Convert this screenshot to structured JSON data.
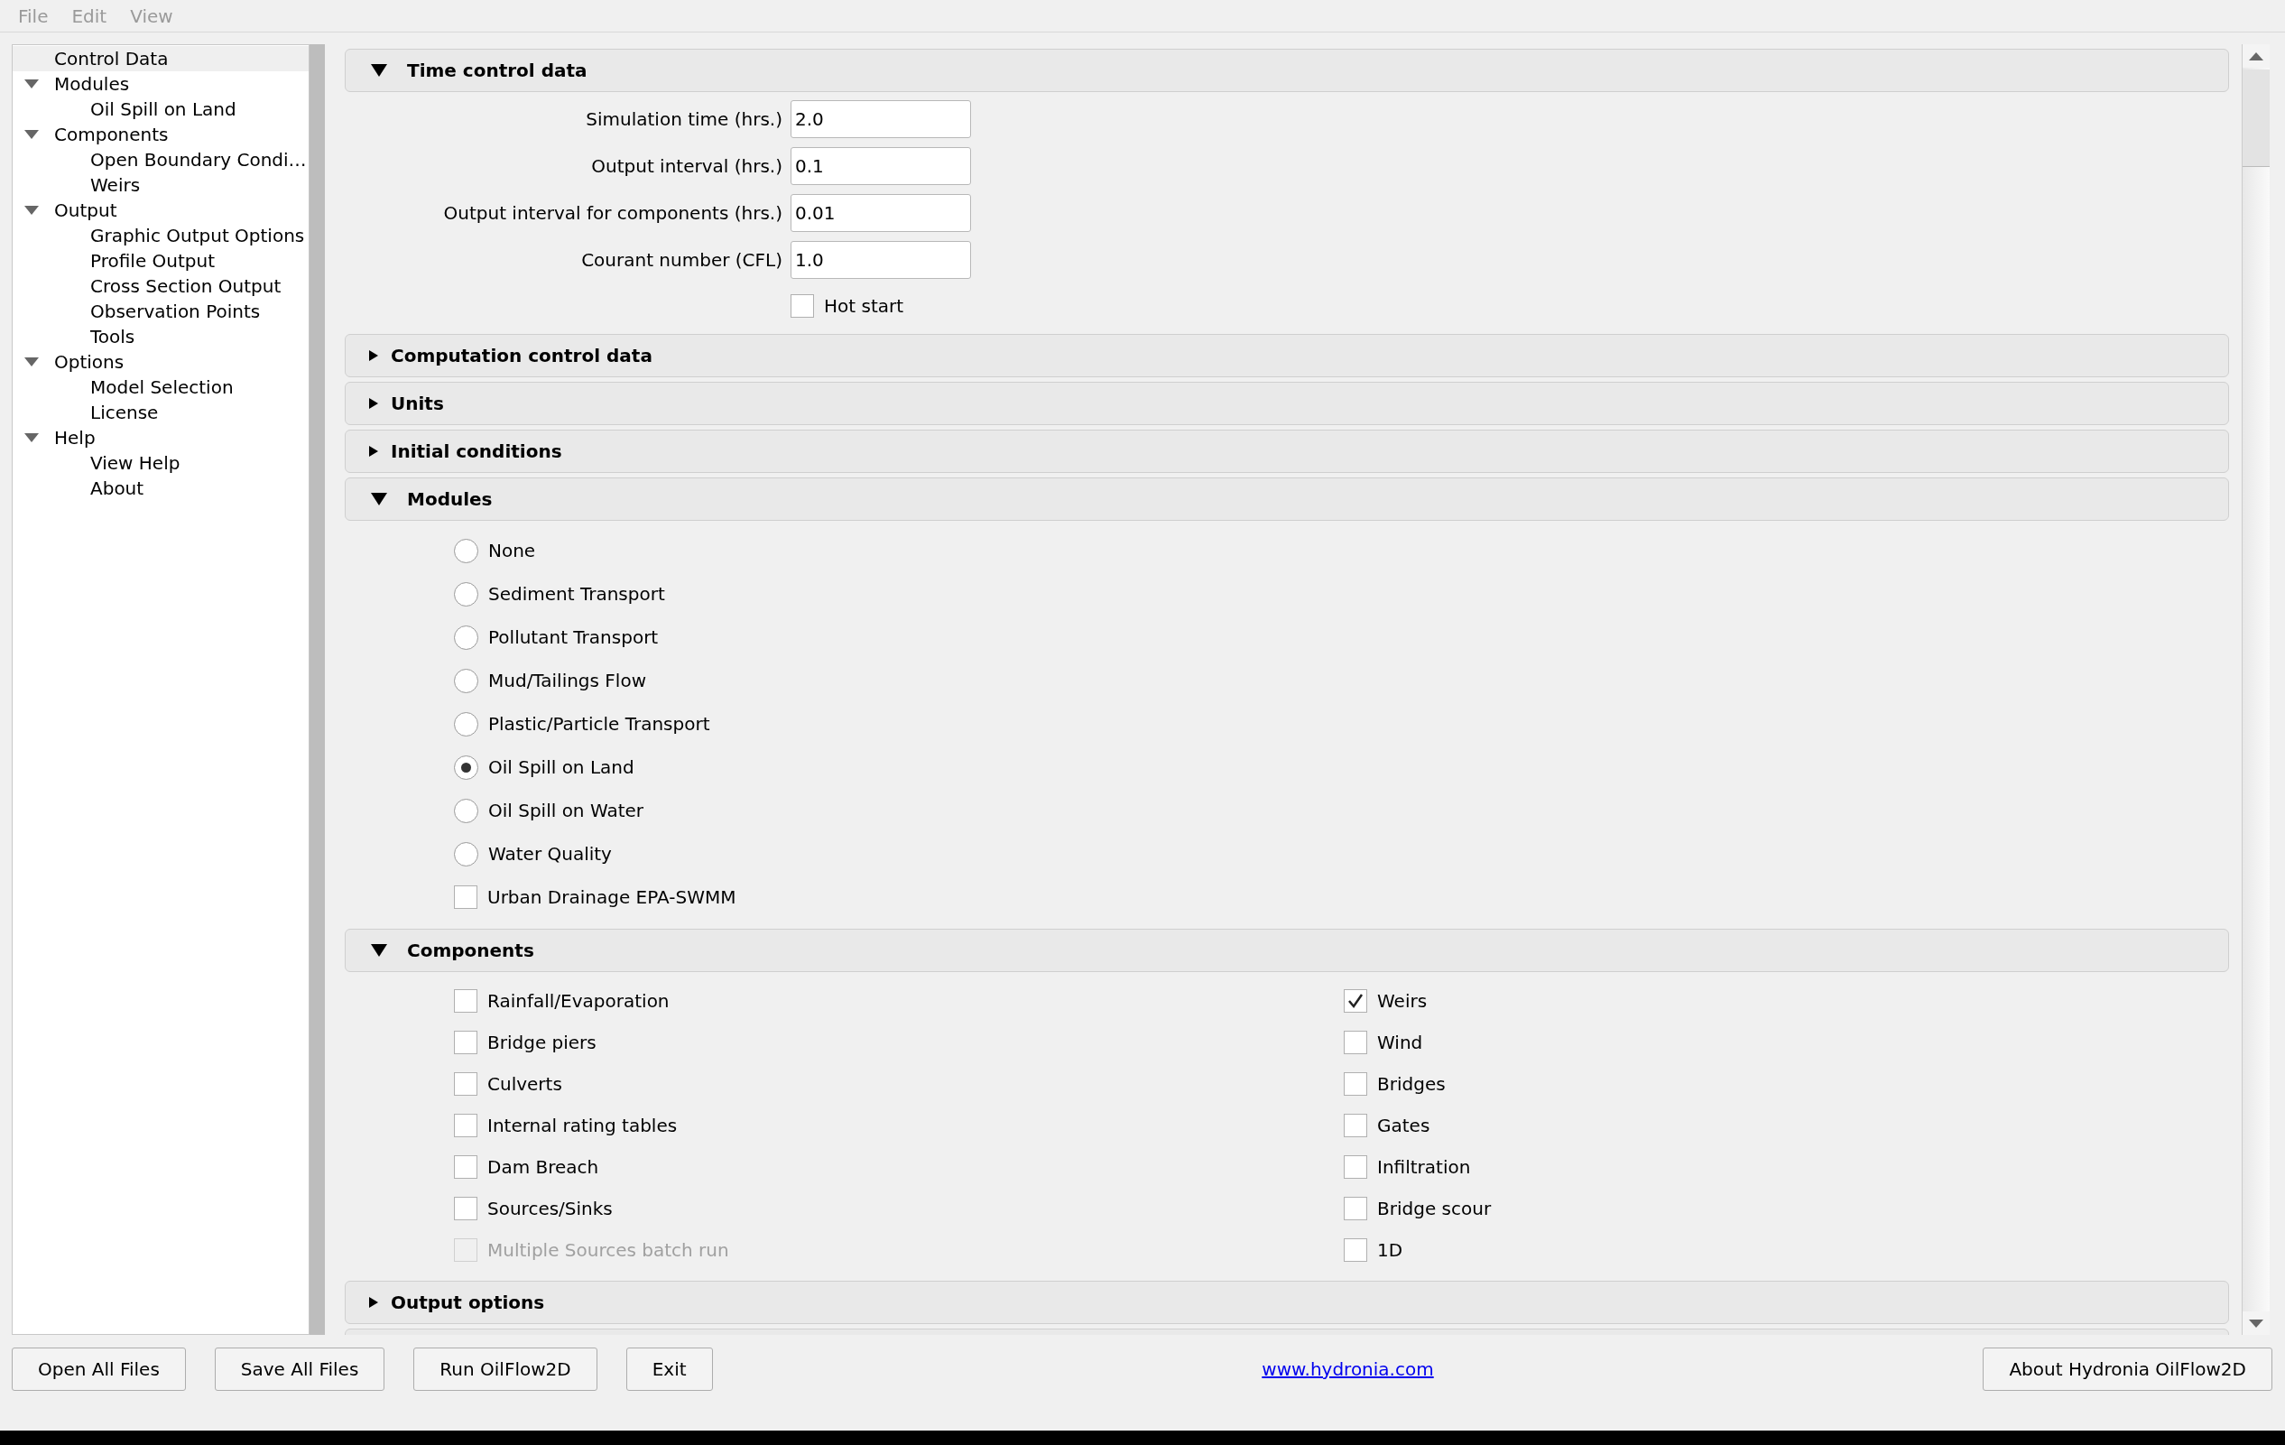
{
  "menu": [
    {
      "label": "File"
    },
    {
      "label": "Edit"
    },
    {
      "label": "View"
    }
  ],
  "tree": [
    {
      "label": "Control Data",
      "selected": true
    },
    {
      "label": "Modules",
      "selected": false,
      "expanded": true,
      "children": [
        {
          "label": "Oil Spill on Land",
          "selected": false
        }
      ]
    },
    {
      "label": "Components",
      "selected": false,
      "expanded": true,
      "children": [
        {
          "label": "Open Boundary Condi…",
          "selected": false
        },
        {
          "label": "Weirs",
          "selected": false
        }
      ]
    },
    {
      "label": "Output",
      "selected": false,
      "expanded": true,
      "children": [
        {
          "label": "Graphic Output Options",
          "selected": false
        },
        {
          "label": "Profile Output",
          "selected": false
        },
        {
          "label": "Cross Section Output",
          "selected": false
        },
        {
          "label": "Observation Points",
          "selected": false
        },
        {
          "label": "Tools",
          "selected": false
        }
      ]
    },
    {
      "label": "Options",
      "selected": false,
      "expanded": true,
      "children": [
        {
          "label": "Model Selection",
          "selected": false
        },
        {
          "label": "License",
          "selected": false
        }
      ]
    },
    {
      "label": "Help",
      "selected": false,
      "expanded": true,
      "children": [
        {
          "label": "View Help",
          "selected": false
        },
        {
          "label": "About",
          "selected": false
        }
      ]
    }
  ],
  "sections": [
    {
      "title": "Time control data",
      "expanded": true,
      "kind": "form",
      "fields": [
        {
          "label": "Simulation time (hrs.)",
          "value": "2.0"
        },
        {
          "label": "Output interval (hrs.)",
          "value": "0.1"
        },
        {
          "label": "Output interval for components (hrs.)",
          "value": "0.01"
        },
        {
          "label": "Courant number (CFL)",
          "value": "1.0"
        }
      ],
      "checkboxes": [
        {
          "label": "Hot start",
          "checked": false
        }
      ]
    },
    {
      "title": "Computation control data",
      "expanded": false
    },
    {
      "title": "Units",
      "expanded": false
    },
    {
      "title": "Initial conditions",
      "expanded": false
    },
    {
      "title": "Modules",
      "expanded": true,
      "kind": "options",
      "options": [
        {
          "kind": "radio",
          "label": "None",
          "selected": false
        },
        {
          "kind": "radio",
          "label": "Sediment Transport",
          "selected": false
        },
        {
          "kind": "radio",
          "label": "Pollutant Transport",
          "selected": false
        },
        {
          "kind": "radio",
          "label": "Mud/Tailings Flow",
          "selected": false
        },
        {
          "kind": "radio",
          "label": "Plastic/Particle Transport",
          "selected": false
        },
        {
          "kind": "radio",
          "label": "Oil Spill on Land",
          "selected": true
        },
        {
          "kind": "radio",
          "label": "Oil Spill on Water",
          "selected": false
        },
        {
          "kind": "radio",
          "label": "Water Quality",
          "selected": false
        },
        {
          "kind": "checkbox",
          "label": "Urban Drainage EPA-SWMM",
          "checked": false
        }
      ]
    },
    {
      "title": "Components",
      "expanded": true,
      "kind": "columns",
      "columns": [
        {
          "items": [
            {
              "label": "Rainfall/Evaporation",
              "checked": false,
              "disabled": false
            },
            {
              "label": "Bridge piers",
              "checked": false,
              "disabled": false
            },
            {
              "label": "Culverts",
              "checked": false,
              "disabled": false
            },
            {
              "label": "Internal rating tables",
              "checked": false,
              "disabled": false
            },
            {
              "label": "Dam Breach",
              "checked": false,
              "disabled": false
            },
            {
              "label": "Sources/Sinks",
              "checked": false,
              "disabled": false
            },
            {
              "label": "Multiple Sources batch run",
              "checked": false,
              "disabled": true
            }
          ]
        },
        {
          "items": [
            {
              "label": "Weirs",
              "checked": true,
              "disabled": false
            },
            {
              "label": "Wind",
              "checked": false,
              "disabled": false
            },
            {
              "label": "Bridges",
              "checked": false,
              "disabled": false
            },
            {
              "label": "Gates",
              "checked": false,
              "disabled": false
            },
            {
              "label": "Infiltration",
              "checked": false,
              "disabled": false
            },
            {
              "label": "Bridge scour",
              "checked": false,
              "disabled": false
            },
            {
              "label": "1D",
              "checked": false,
              "disabled": false
            }
          ]
        }
      ]
    },
    {
      "title": "Output options",
      "expanded": false
    },
    {
      "expanded": false
    }
  ],
  "footer": {
    "buttons": [
      {
        "label": "Open All Files"
      },
      {
        "label": "Save All Files"
      },
      {
        "label": "Run OilFlow2D"
      },
      {
        "label": "Exit"
      }
    ],
    "link": "www.hydronia.com",
    "about_button": "About Hydronia OilFlow2D"
  }
}
